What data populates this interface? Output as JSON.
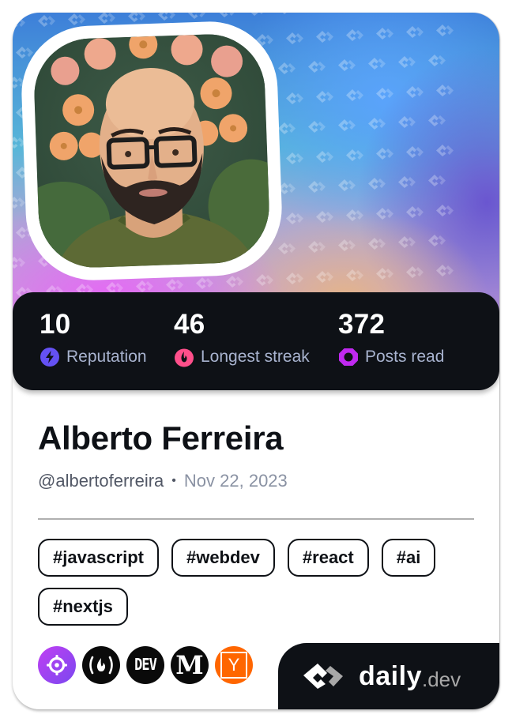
{
  "profile": {
    "name": "Alberto Ferreira",
    "handle": "@albertoferreira",
    "separator": "•",
    "joined": "Nov 22, 2023",
    "avatar": "portrait-illustration"
  },
  "stats": [
    {
      "value": "10",
      "label": "Reputation",
      "icon": "lightning-icon",
      "color": "#6451f3"
    },
    {
      "value": "46",
      "label": "Longest streak",
      "icon": "flame-icon",
      "color": "#ff4f8b"
    },
    {
      "value": "372",
      "label": "Posts read",
      "icon": "ring-icon",
      "color": "#c029f0"
    }
  ],
  "tags": [
    "#javascript",
    "#webdev",
    "#react",
    "#ai",
    "#nextjs"
  ],
  "sources": [
    {
      "name": "crosshair-source",
      "icon": "crosshair-icon",
      "bg": "#9a3cf0"
    },
    {
      "name": "freecodecamp",
      "icon": "flame-brackets-icon",
      "bg": "#0a0a0a",
      "text": "(🔥)"
    },
    {
      "name": "dev-to",
      "icon": "dev-icon",
      "bg": "#0a0a0a",
      "text": "DEV"
    },
    {
      "name": "medium",
      "icon": "medium-icon",
      "bg": "#0a0a0a",
      "text": "M"
    },
    {
      "name": "hacker-news",
      "icon": "y-icon",
      "bg": "#ff6600",
      "text": "Y"
    }
  ],
  "brand": {
    "daily": "daily",
    "dev": ".dev"
  },
  "colors": {
    "dark": "#0e1116",
    "label": "#a8b3cf",
    "accent": "#6451f3"
  }
}
